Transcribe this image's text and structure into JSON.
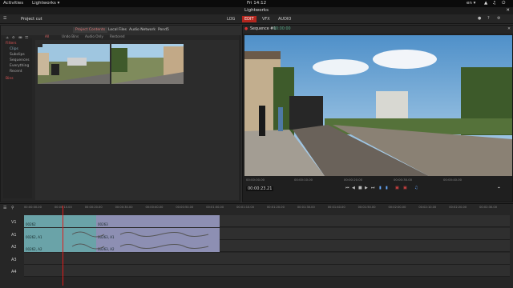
{
  "system_bar": {
    "activities": "Activities",
    "app_menu": "Lightworks ▾",
    "clock": "Fri 14:12",
    "locale": "en ▾"
  },
  "window": {
    "title": "Lightworks"
  },
  "app_bar": {
    "project": "Project cut",
    "tabs": [
      "LOG",
      "EDIT",
      "VFX",
      "AUDIO"
    ],
    "active_tab": 1
  },
  "project_panel": {
    "tabs": [
      "Project Contents",
      "Local Files",
      "Audio Network",
      "Pond5"
    ],
    "sub_tabs": [
      "All",
      "Undo Bins",
      "Audio Only",
      "Restored"
    ],
    "bins_title": "Filters",
    "bins": [
      "Clips",
      "Subclips",
      "Sequences",
      "Everything",
      "Recent"
    ],
    "bins2": "Bins"
  },
  "viewer": {
    "title": "Sequence #1",
    "timecode_badge": "00:00:00",
    "timecode": "00:00:23.21",
    "ruler": [
      "00:00:00.00",
      "00:00:10.00",
      "00:00:20.00",
      "00:00:30.00",
      "00:00:40.00"
    ]
  },
  "timeline": {
    "ruler": [
      "00:00:00.00",
      "00:00:10.00",
      "00:00:20.00",
      "00:00:30.00",
      "00:00:40.00",
      "00:00:50.00",
      "00:01:00.00",
      "00:01:10.00",
      "00:01:20.00",
      "00:01:30.00",
      "00:01:40.00",
      "00:01:50.00",
      "00:02:00.00",
      "00:02:10.00",
      "00:02:20.00",
      "00:02:30.00"
    ],
    "tracks": [
      "V1",
      "A1",
      "A2",
      "A3",
      "A4"
    ],
    "clips": {
      "v1_a": "00262",
      "v1_b": "00263",
      "a1_a": "00262, A1",
      "a1_b": "00263, A1",
      "a2_a": "00262, A2",
      "a2_b": "00263, A2"
    },
    "playhead_fraction": 0.08
  }
}
